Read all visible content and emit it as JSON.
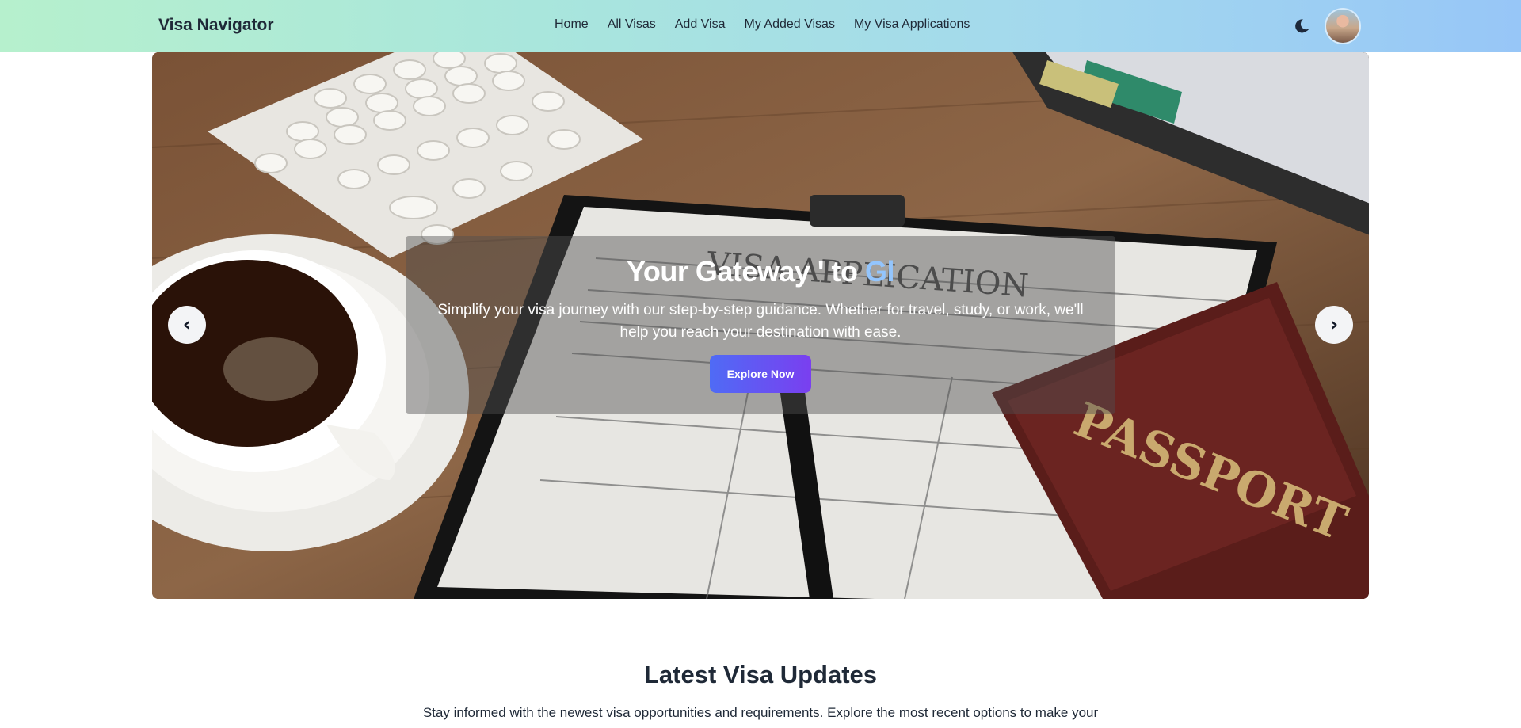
{
  "navbar": {
    "brand": "Visa Navigator",
    "links": [
      "Home",
      "All Visas",
      "Add Visa",
      "My Added Visas",
      "My Visa Applications"
    ],
    "theme_icon": "moon-icon",
    "avatar_icon": "user-avatar"
  },
  "hero": {
    "title_main": "Your Gateway ' to ",
    "title_accent": "Gl",
    "subtitle": "Simplify your visa journey with our step-by-step guidance. Whether for travel, study, or work, we'll help you reach your destination with ease.",
    "cta_label": "Explore Now",
    "prev_label": "‹",
    "next_label": "›"
  },
  "section": {
    "title": "Latest Visa Updates",
    "description": "Stay informed with the newest visa opportunities and requirements. Explore the most recent options to make your"
  },
  "colors": {
    "accent_text": "#93c5fd",
    "cta_gradient_start": "#4f6bf5",
    "cta_gradient_end": "#7a3ff0"
  }
}
